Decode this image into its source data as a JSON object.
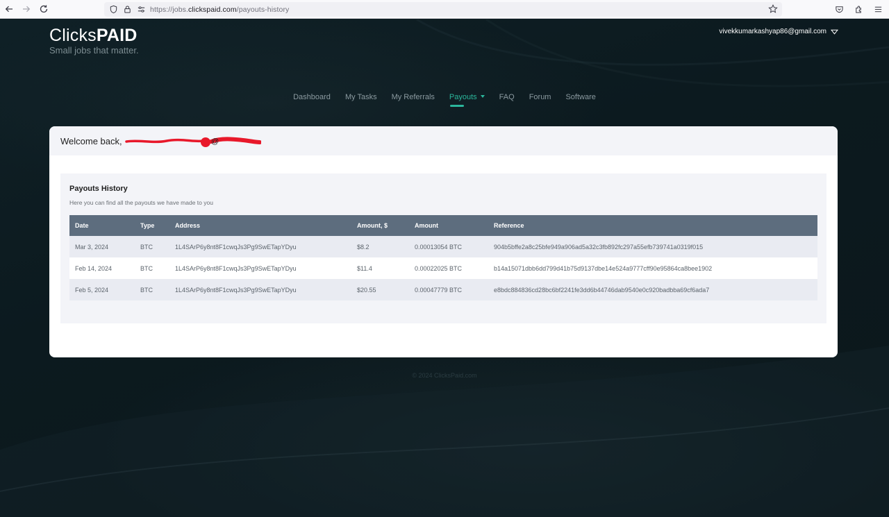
{
  "browser": {
    "url_prefix": "https://jobs.",
    "url_domain": "clickspaid.com",
    "url_path": "/payouts-history"
  },
  "logo": {
    "light": "Clicks",
    "bold": "PAID",
    "tagline": "Small jobs that matter."
  },
  "user": {
    "email": "vivekkumarkashyap86@gmail.com"
  },
  "nav": {
    "items": [
      {
        "label": "Dashboard"
      },
      {
        "label": "My Tasks"
      },
      {
        "label": "My Referrals"
      },
      {
        "label": "Payouts"
      },
      {
        "label": "FAQ"
      },
      {
        "label": "Forum"
      },
      {
        "label": "Software"
      }
    ]
  },
  "welcome": {
    "prefix": "Welcome back,"
  },
  "payouts": {
    "title": "Payouts History",
    "subtitle": "Here you can find all the payouts we have made to you",
    "columns": [
      "Date",
      "Type",
      "Address",
      "Amount, $",
      "Amount",
      "Reference"
    ],
    "rows": [
      {
        "date": "Mar 3, 2024",
        "type": "BTC",
        "address": "1L4SArP6y8nt8F1cwqJs3Pg9SwETapYDyu",
        "usd": "$8.2",
        "amount": "0.00013054 BTC",
        "reference": "904b5bffe2a8c25bfe949a906ad5a32c3fb892fc297a55efb739741a0319f015"
      },
      {
        "date": "Feb 14, 2024",
        "type": "BTC",
        "address": "1L4SArP6y8nt8F1cwqJs3Pg9SwETapYDyu",
        "usd": "$11.4",
        "amount": "0.00022025 BTC",
        "reference": "b14a15071dbb6dd799d41b75d9137dbe14e524a9777cff90e95864ca8bee1902"
      },
      {
        "date": "Feb 5, 2024",
        "type": "BTC",
        "address": "1L4SArP6y8nt8F1cwqJs3Pg9SwETapYDyu",
        "usd": "$20.55",
        "amount": "0.00047779 BTC",
        "reference": "e8bdc884836cd28bc6bf2241fe3dd6b44746dab9540e0c920badbba69cf6ada7"
      }
    ]
  },
  "footer": {
    "text": "© 2024 ClicksPaid.com"
  },
  "colors": {
    "accent": "#2bb79c",
    "table_header": "#5d6d7e",
    "redaction": "#e8182a"
  }
}
